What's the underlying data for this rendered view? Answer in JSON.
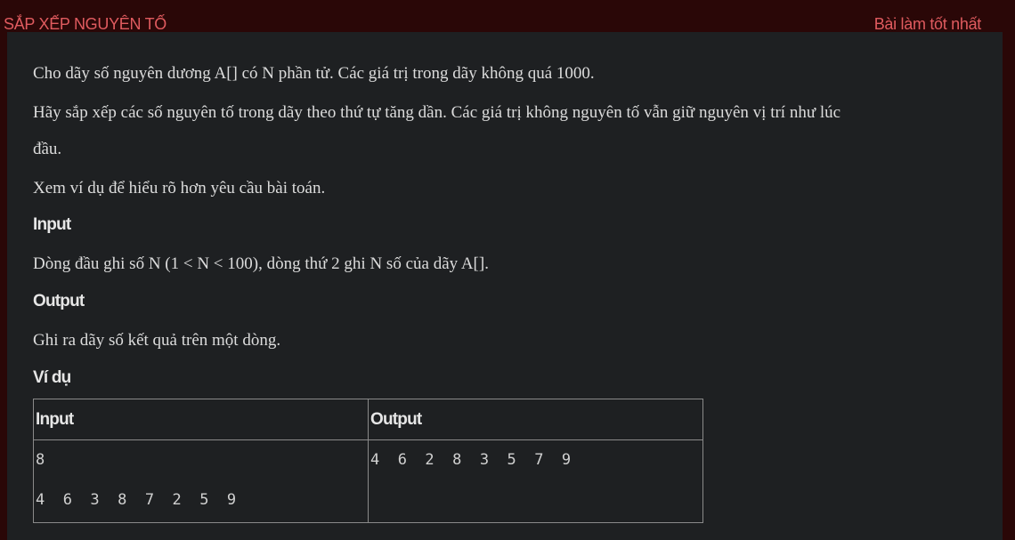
{
  "header": {
    "title": "SẮP XẾP NGUYÊN TỐ",
    "best_link": "Bài làm tốt nhất"
  },
  "problem": {
    "para1": "Cho dãy số nguyên dương A[] có N phần tử. Các giá trị trong dãy không quá 1000.",
    "para2_line1": "Hãy sắp xếp các số nguyên tố trong dãy theo thứ tự tăng dần. Các giá trị không nguyên tố vẫn giữ nguyên vị trí như lúc",
    "para2_line2": "đầu.",
    "para3": "Xem ví dụ để hiểu rõ hơn yêu cầu bài toán.",
    "input_heading": "Input",
    "input_desc": "Dòng đầu ghi số N (1 < N < 100), dòng thứ 2 ghi N số của dãy A[].",
    "output_heading": "Output",
    "output_desc": "Ghi ra dãy số kết quả trên một dòng.",
    "example_heading": "Ví dụ"
  },
  "example_table": {
    "headers": [
      "Input",
      "Output"
    ],
    "input_lines": [
      "8",
      "4 6 3 8 7 2 5 9"
    ],
    "output_lines": [
      "4 6 2 8 3 5 7 9"
    ]
  }
}
